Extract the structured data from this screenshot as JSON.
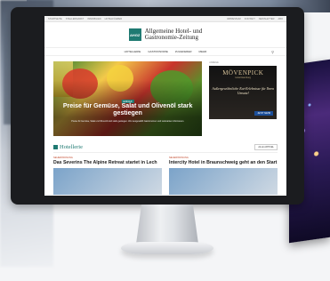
{
  "site": {
    "topbar_left": [
      "STARTSEITE",
      "STELLENMARKT",
      "IMMOBILIEN",
      "HOTELFÜHRER"
    ],
    "topbar_right": [
      "IMPRESSUM",
      "KONTAKT",
      "NEWSLETTER",
      "ABO"
    ],
    "logo_badge": "AHGZ",
    "title_line1": "Allgemeine Hotel- und",
    "title_line2": "Gastronomie-Zeitung",
    "nav": [
      "HOTELLERIE",
      "GASTRONOMIE",
      "ZULIEFERER",
      "MEHR"
    ]
  },
  "hero": {
    "kicker": "EINKAUF",
    "headline": "Preise für Gemüse, Salat und Olivenöl stark gestiegen",
    "teaser": "Preise für Gemüse, Salat und Olivenöl sind stark gestiegen. Wer ausgewählt Gastronomen und Lieferanten informieren."
  },
  "ad": {
    "label": "ANZEIGE",
    "brand": "MÖVENPICK",
    "sub": "Hotel Hamburg",
    "script": "Außergewöhnliche Eat-Erlebnisse für Ihren Umsatz!",
    "cta": "JETZT MEHR"
  },
  "section": {
    "name": "Hotellerie",
    "all_button": "ALLE ARTIKEL"
  },
  "cards": [
    {
      "tag": "NEUERÖFFNUNG",
      "headline": "Das Severins The Alpine Retreat startet in Lech"
    },
    {
      "tag": "NEUERÖFFNUNG",
      "headline": "Intercity Hotel in Braunschweig geht an den Start"
    }
  ],
  "colors": {
    "brand": "#1f7a72",
    "accent": "#c24a2d"
  }
}
